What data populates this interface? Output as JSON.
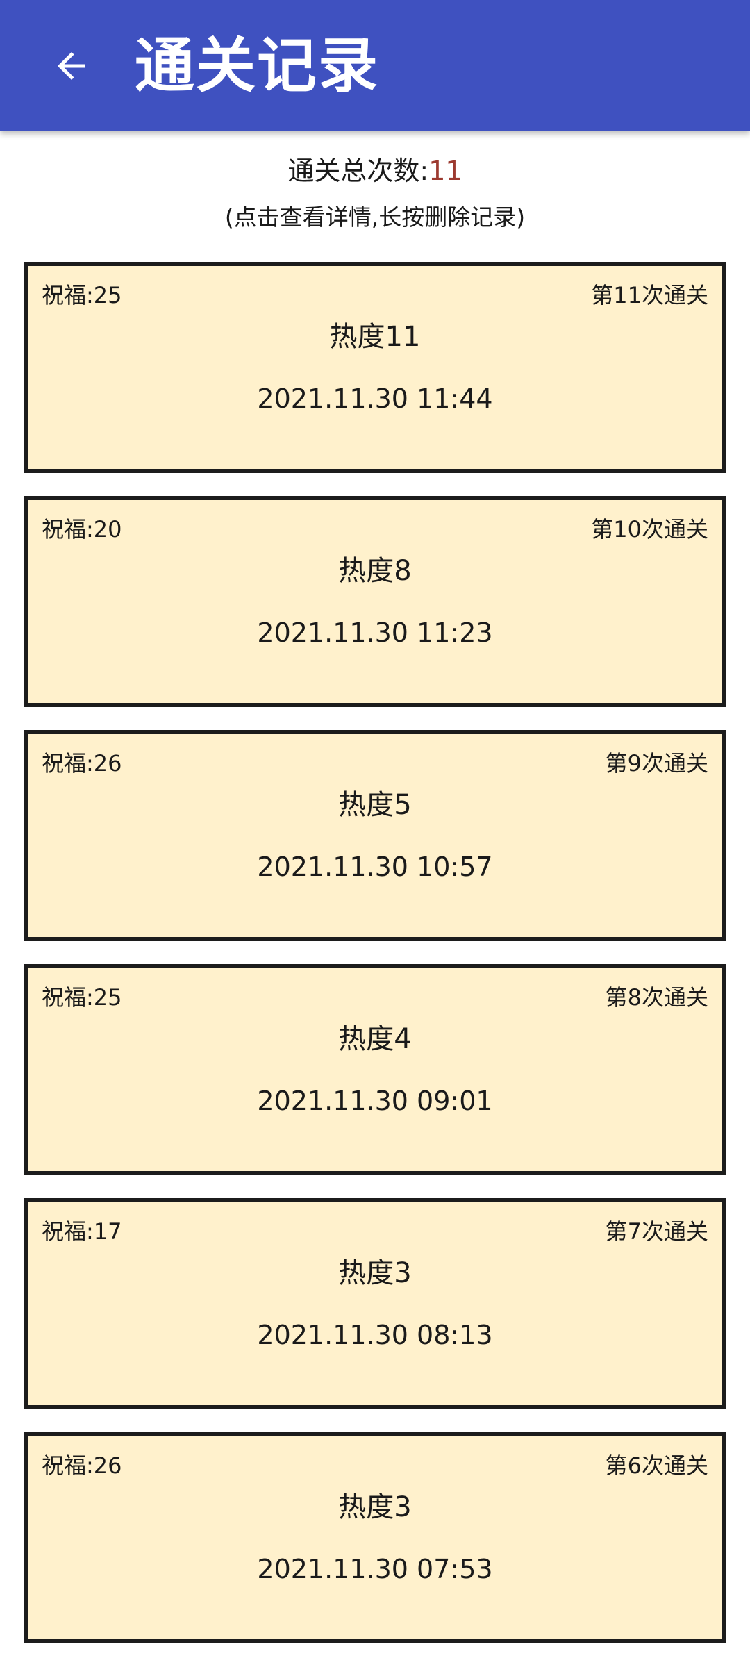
{
  "app_bar": {
    "title": "通关记录",
    "back_icon": "arrow-left-icon"
  },
  "summary": {
    "label": "通关总次数:",
    "count": "11",
    "count_color": "#9c3a30",
    "hint": "(点击查看详情,长按删除记录)"
  },
  "colors": {
    "app_bar": "#3f51c0",
    "card_background": "#fff1cc",
    "card_border": "#1c1c1c"
  },
  "records": [
    {
      "blessing": "祝福:25",
      "clear_no": "第11次通关",
      "heat": "热度11",
      "datetime": "2021.11.30 11:44"
    },
    {
      "blessing": "祝福:20",
      "clear_no": "第10次通关",
      "heat": "热度8",
      "datetime": "2021.11.30 11:23"
    },
    {
      "blessing": "祝福:26",
      "clear_no": "第9次通关",
      "heat": "热度5",
      "datetime": "2021.11.30 10:57"
    },
    {
      "blessing": "祝福:25",
      "clear_no": "第8次通关",
      "heat": "热度4",
      "datetime": "2021.11.30 09:01"
    },
    {
      "blessing": "祝福:17",
      "clear_no": "第7次通关",
      "heat": "热度3",
      "datetime": "2021.11.30 08:13"
    },
    {
      "blessing": "祝福:26",
      "clear_no": "第6次通关",
      "heat": "热度3",
      "datetime": "2021.11.30 07:53"
    }
  ]
}
